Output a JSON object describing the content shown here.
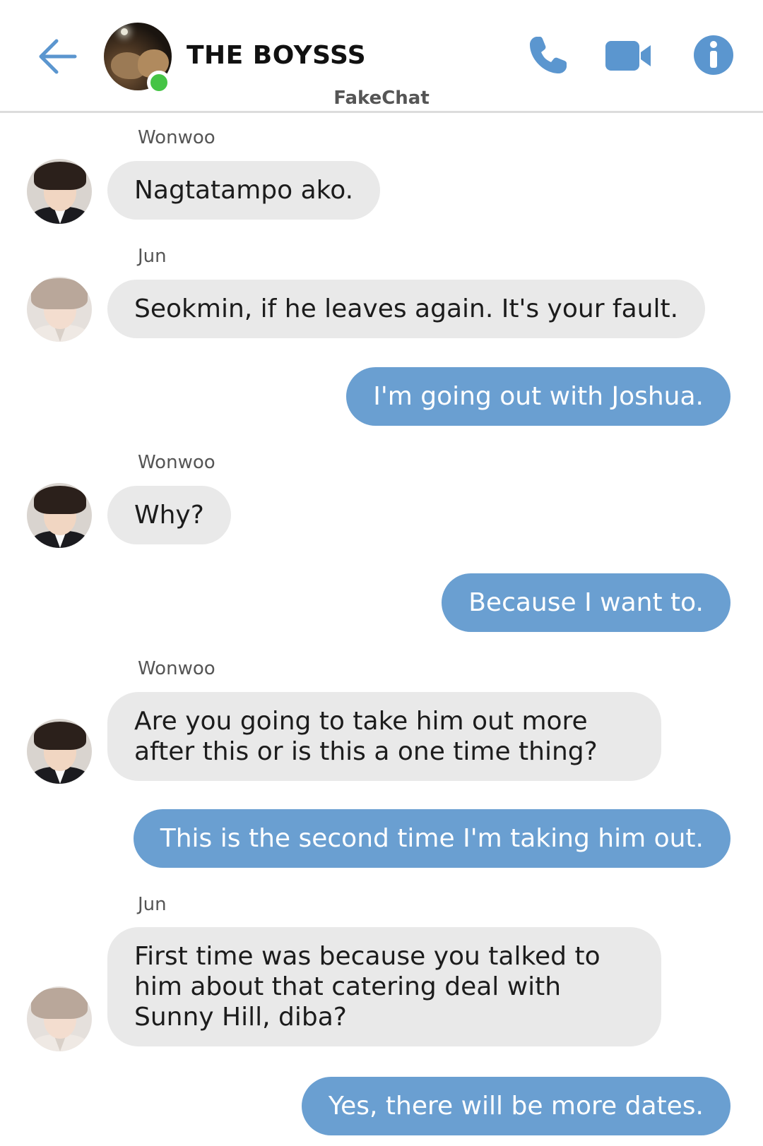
{
  "header": {
    "title": "THE BOYSSS",
    "watermark": "FakeChat",
    "accent_color": "#5b96cf",
    "online_color": "#45c445",
    "icons": [
      "back-arrow-icon",
      "phone-icon",
      "video-camera-icon",
      "info-icon"
    ]
  },
  "messages": [
    {
      "sender": "Wonwoo",
      "text": "Nagtatampo ako.",
      "direction": "incoming"
    },
    {
      "sender": "Jun",
      "text": "Seokmin, if he leaves again. It's your fault.",
      "direction": "incoming"
    },
    {
      "text": "I'm going out with Joshua.",
      "direction": "outgoing"
    },
    {
      "sender": "Wonwoo",
      "text": "Why?",
      "direction": "incoming"
    },
    {
      "text": "Because I want to.",
      "direction": "outgoing"
    },
    {
      "sender": "Wonwoo",
      "text": "Are you going to take him out more after this or is this a one time thing?",
      "direction": "incoming"
    },
    {
      "text": "This is the second time I'm taking him out.",
      "direction": "outgoing"
    },
    {
      "sender": "Jun",
      "text": "First time was because you talked to him about that catering deal with Sunny Hill, diba?",
      "direction": "incoming"
    },
    {
      "text": "Yes, there will be more dates.",
      "direction": "outgoing"
    }
  ],
  "colors": {
    "incoming_bubble": "#e9e9e9",
    "outgoing_bubble": "#6a9fd1"
  }
}
